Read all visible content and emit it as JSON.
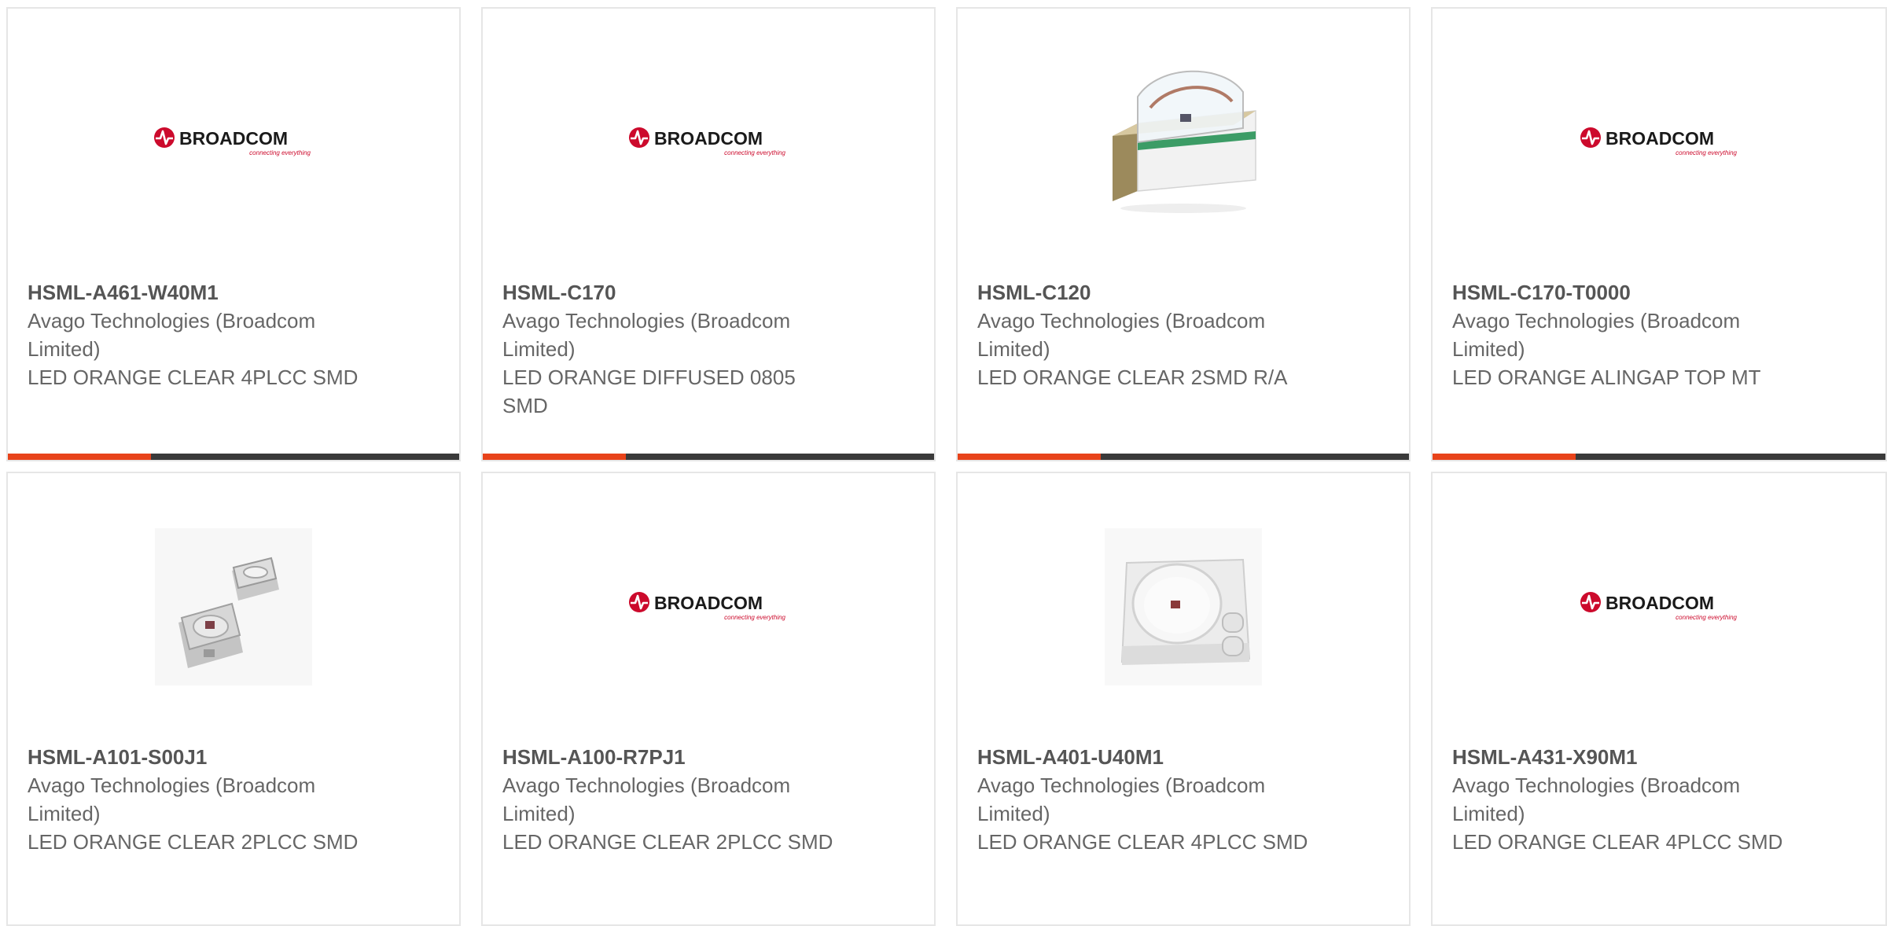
{
  "brand": {
    "logo_word": "BROADCOM",
    "logo_tagline": "connecting everything",
    "logo_color": "#cc0a2c",
    "accent_color": "#e8431a",
    "bar_color": "#3a3a3a"
  },
  "products": [
    {
      "part_number": "HSML-A461-W40M1",
      "manufacturer": "Avago Technologies (Broadcom Limited)",
      "description": "LED ORANGE CLEAR 4PLCC SMD",
      "image": "broadcom-logo"
    },
    {
      "part_number": "HSML-C170",
      "manufacturer": "Avago Technologies (Broadcom Limited)",
      "description": "LED ORANGE DIFFUSED 0805 SMD",
      "image": "broadcom-logo"
    },
    {
      "part_number": "HSML-C120",
      "manufacturer": "Avago Technologies (Broadcom Limited)",
      "description": "LED ORANGE CLEAR 2SMD R/A",
      "image": "right-angle-led-photo"
    },
    {
      "part_number": "HSML-C170-T0000",
      "manufacturer": "Avago Technologies (Broadcom Limited)",
      "description": "LED ORANGE ALINGAP TOP MT",
      "image": "broadcom-logo"
    },
    {
      "part_number": "HSML-A101-S00J1",
      "manufacturer": "Avago Technologies (Broadcom Limited)",
      "description": "LED ORANGE CLEAR 2PLCC SMD",
      "image": "plcc2-led-photo"
    },
    {
      "part_number": "HSML-A100-R7PJ1",
      "manufacturer": "Avago Technologies (Broadcom Limited)",
      "description": "LED ORANGE CLEAR 2PLCC SMD",
      "image": "broadcom-logo"
    },
    {
      "part_number": "HSML-A401-U40M1",
      "manufacturer": "Avago Technologies (Broadcom Limited)",
      "description": "LED ORANGE CLEAR 4PLCC SMD",
      "image": "plcc4-led-photo"
    },
    {
      "part_number": "HSML-A431-X90M1",
      "manufacturer": "Avago Technologies (Broadcom Limited)",
      "description": "LED ORANGE CLEAR 4PLCC SMD",
      "image": "broadcom-logo"
    }
  ]
}
